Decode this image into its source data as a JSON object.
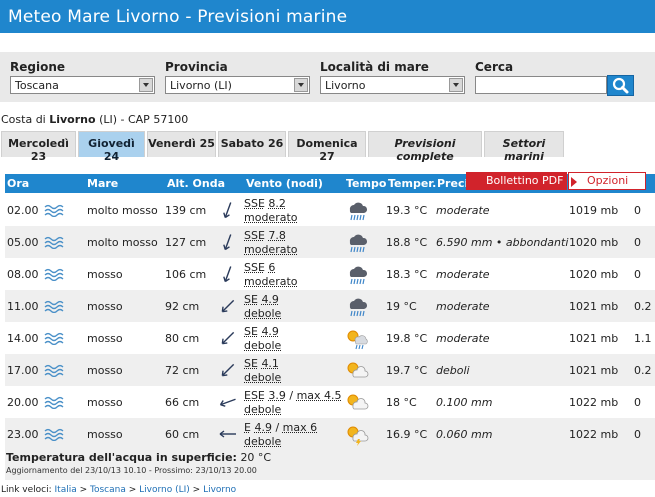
{
  "header": {
    "title": "Meteo Mare Livorno - Previsioni marine"
  },
  "search": {
    "regione_label": "Regione",
    "regione_value": "Toscana",
    "provincia_label": "Provincia",
    "provincia_value": "Livorno (LI)",
    "localita_label": "Località di mare",
    "localita_value": "Livorno",
    "cerca_label": "Cerca"
  },
  "location": {
    "prefix": "Costa di",
    "city": "Livorno",
    "suffix": "(LI) - CAP 57100"
  },
  "tabs": [
    {
      "label": "Mercoledì 23"
    },
    {
      "label": "Giovedì 24"
    },
    {
      "label": "Venerdì 25"
    },
    {
      "label": "Sabato 26"
    },
    {
      "label": "Domenica 27"
    },
    {
      "label": "Previsioni complete"
    },
    {
      "label": "Settori marini"
    }
  ],
  "table": {
    "headers": {
      "ora": "Ora",
      "mare": "Mare",
      "onda": "Alt. Onda",
      "vento": "Vento (nodi)",
      "tempo": "Tempo",
      "temper": "Temper.",
      "prec": "Preci"
    },
    "rows": [
      {
        "ora": "02.00",
        "mare": "molto mosso",
        "onda": "139 cm",
        "dir": "SSE",
        "kn": "8.2",
        "max": "",
        "forza": "moderato",
        "temp": "19.3 °C",
        "prec": "moderate",
        "press": "1019 mb",
        "extra": "0",
        "weather": "rain",
        "arrow": 200
      },
      {
        "ora": "05.00",
        "mare": "molto mosso",
        "onda": "127 cm",
        "dir": "SSE",
        "kn": "7.8",
        "max": "",
        "forza": "moderato",
        "temp": "18.8 °C",
        "prec": "6.590 mm • abbondanti",
        "press": "1020 mb",
        "extra": "0",
        "weather": "rain",
        "arrow": 200
      },
      {
        "ora": "08.00",
        "mare": "mosso",
        "onda": "106 cm",
        "dir": "SSE",
        "kn": "6",
        "max": "",
        "forza": "moderato",
        "temp": "18.3 °C",
        "prec": "moderate",
        "press": "1020 mb",
        "extra": "0",
        "weather": "rain",
        "arrow": 200
      },
      {
        "ora": "11.00",
        "mare": "mosso",
        "onda": "92 cm",
        "dir": "SE",
        "kn": "4.9",
        "max": "",
        "forza": "debole",
        "temp": "19 °C",
        "prec": "moderate",
        "press": "1021 mb",
        "extra": "0.2",
        "weather": "rain",
        "arrow": 225
      },
      {
        "ora": "14.00",
        "mare": "mosso",
        "onda": "80 cm",
        "dir": "SE",
        "kn": "4.9",
        "max": "",
        "forza": "debole",
        "temp": "19.8 °C",
        "prec": "moderate",
        "press": "1021 mb",
        "extra": "1.1",
        "weather": "sun-rain",
        "arrow": 225
      },
      {
        "ora": "17.00",
        "mare": "mosso",
        "onda": "72 cm",
        "dir": "SE",
        "kn": "4.1",
        "max": "",
        "forza": "debole",
        "temp": "19.7 °C",
        "prec": "deboli",
        "press": "1021 mb",
        "extra": "0.2",
        "weather": "sun-cloud",
        "arrow": 225
      },
      {
        "ora": "20.00",
        "mare": "mosso",
        "onda": "66 cm",
        "dir": "ESE",
        "kn": "3.9",
        "max": "max 4.5",
        "forza": "debole",
        "temp": "18 °C",
        "prec": "0.100 mm",
        "press": "1022 mb",
        "extra": "0",
        "weather": "sun-cloud",
        "arrow": 250
      },
      {
        "ora": "23.00",
        "mare": "mosso",
        "onda": "60 cm",
        "dir": "E",
        "kn": "4.9",
        "max": "max 6",
        "forza": "debole",
        "temp": "16.9 °C",
        "prec": "0.060 mm",
        "press": "1022 mb",
        "extra": "0",
        "weather": "sun-storm",
        "arrow": 270
      }
    ]
  },
  "footer": {
    "water_label": "Temperatura dell'acqua in superficie:",
    "water_value": "20 °C",
    "update": "Aggiornamento del 23/10/13 10.10 - Prossimo: 23/10/13 20.00"
  },
  "links": {
    "prefix": "Link veloci:",
    "items": [
      "Italia",
      "Toscana",
      "Livorno (LI)",
      "Livorno"
    ]
  },
  "popup": {
    "pdf": "Bollettino PDF",
    "opzioni": "Opzioni"
  },
  "colors": {
    "header": "#1f86cd",
    "accent_red": "#d1232b",
    "tab_active": "#aad1ee"
  }
}
